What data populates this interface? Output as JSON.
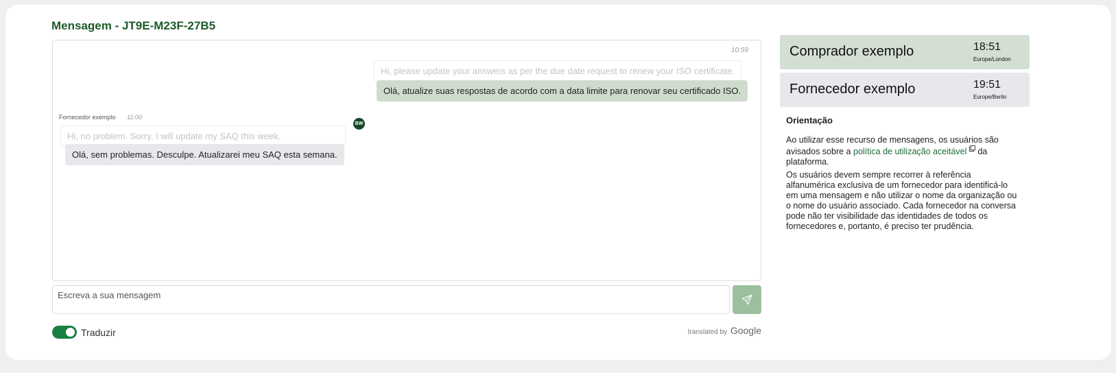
{
  "page_title": "Mensagem - JT9E-M23F-27B5",
  "conversation": {
    "messages": [
      {
        "time": "10:59",
        "original": "Hi, please update your answers as per the due date request to renew your ISO certificate.",
        "translated": "Olá, atualize suas respostas de acordo com a data limite para renovar seu certificado ISO."
      },
      {
        "sender": "Fornecedor exemplo",
        "time": "11:00",
        "original": "Hi, no problem. Sorry. I will update my SAQ this week.",
        "translated": "Olá, sem problemas. Desculpe. Atualizarei meu SAQ esta semana.",
        "avatar_initials": "BW"
      }
    ]
  },
  "composer": {
    "placeholder": "Escreva a sua mensagem",
    "send_icon": "send-icon"
  },
  "translate": {
    "label": "Traduzir",
    "enabled": true,
    "credit_prefix": "translated by",
    "credit_brand": "Google"
  },
  "participants": {
    "buyer": {
      "name": "Comprador exemplo",
      "time": "18:51",
      "timezone": "Europe/London"
    },
    "supplier": {
      "name": "Fornecedor exemplo",
      "time": "19:51",
      "timezone": "Europe/Berlin"
    }
  },
  "guidance": {
    "title": "Orientação",
    "p1_before": "Ao utilizar esse recurso de mensagens, os usuários são avisados sobre a",
    "p1_link": "política de utilização aceitável",
    "p1_after": "da plataforma.",
    "p2": "Os usuários devem sempre recorrer à referência alfanumérica exclusiva de um fornecedor para identificá-lo em uma mensagem e não utilizar o nome da organização ou o nome do usuário associado. Cada fornecedor na conversa pode não ter visibilidade das identidades de todos os fornecedores e, portanto, é preciso ter prudência."
  },
  "colors": {
    "brand_green": "#1e5a2a",
    "buyer_bg": "#d3dfd2",
    "supplier_bg": "#e6e8eb",
    "toggle_on": "#178043",
    "send_button": "#9cc09f"
  }
}
